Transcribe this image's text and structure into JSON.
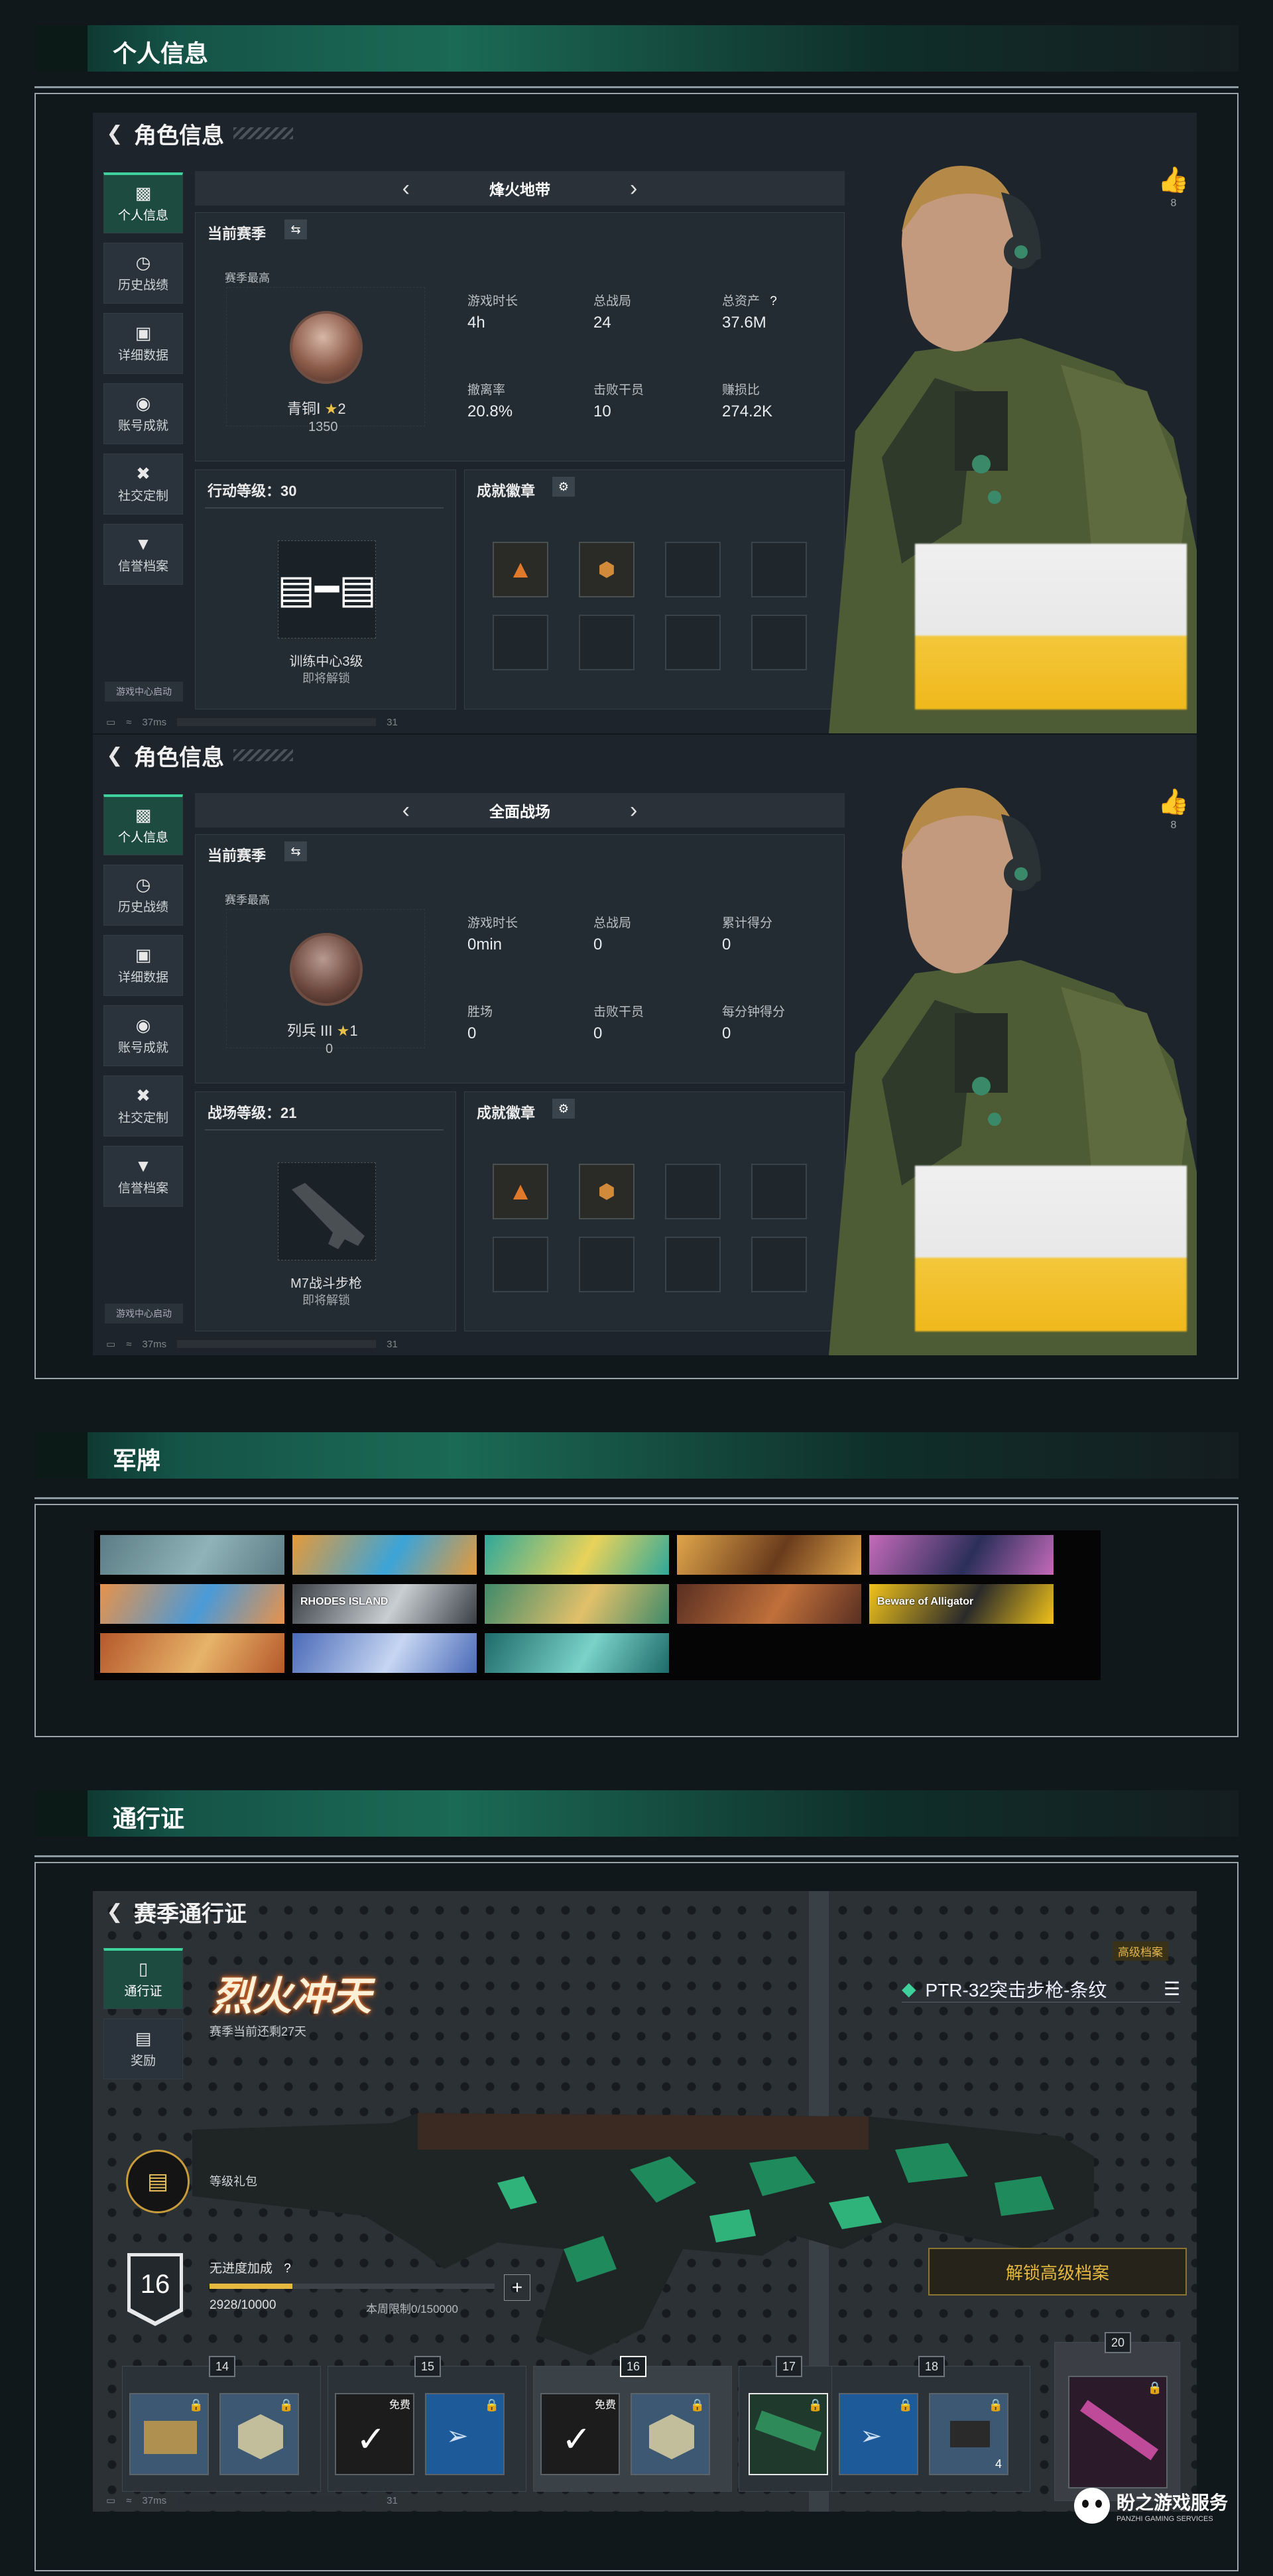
{
  "sections": {
    "personal": "个人信息",
    "plaques": "军牌",
    "pass": "通行证"
  },
  "profile": {
    "title": "角色信息",
    "sidebar": [
      "个人信息",
      "历史战绩",
      "详细数据",
      "账号成就",
      "社交定制",
      "信誉档案"
    ],
    "game_center": "游戏中心启动",
    "likes": "8",
    "status": {
      "ping": "37ms",
      "right": "31"
    },
    "season_label": "当前赛季",
    "season_best": "赛季最高",
    "achievements_label": "成就徽章",
    "panels": [
      {
        "mode": "烽火地带",
        "rank_name": "青铜Ⅰ",
        "rank_stars": "2",
        "rank_points": "1350",
        "stats": [
          {
            "label": "游戏时长",
            "value": "4h"
          },
          {
            "label": "总战局",
            "value": "24"
          },
          {
            "label": "总资产",
            "value": "37.6M",
            "help": "?"
          },
          {
            "label": "撤离率",
            "value": "20.8%"
          },
          {
            "label": "击败干员",
            "value": "10"
          },
          {
            "label": "赚损比",
            "value": "274.2K"
          }
        ],
        "level_title": "行动等级：30",
        "unlock_name": "训练中心3级",
        "unlock_hint": "即将解锁"
      },
      {
        "mode": "全面战场",
        "rank_name": "列兵 III",
        "rank_stars": "1",
        "rank_points": "0",
        "stats": [
          {
            "label": "游戏时长",
            "value": "0min"
          },
          {
            "label": "总战局",
            "value": "0"
          },
          {
            "label": "累计得分",
            "value": "0"
          },
          {
            "label": "胜场",
            "value": "0"
          },
          {
            "label": "击败干员",
            "value": "0"
          },
          {
            "label": "每分钟得分",
            "value": "0"
          }
        ],
        "level_title": "战场等级：21",
        "unlock_name": "M7战斗步枪",
        "unlock_hint": "即将解锁"
      }
    ]
  },
  "plaques": {
    "tiles": [
      {
        "color": "#5b7c84",
        "accent": "#8fb3b8"
      },
      {
        "color": "#e59a3a",
        "accent": "#3ba4d8"
      },
      {
        "color": "#2fa89a",
        "accent": "#e8d25a"
      },
      {
        "color": "#e0a54a",
        "accent": "#6a3b1c"
      },
      {
        "color": "#c46ab8",
        "accent": "#2b2f5a"
      },
      {
        "color": "#e8924a",
        "accent": "#4a9ad8"
      },
      {
        "color": "#3a3f46",
        "accent": "#c9ced2",
        "text": "RHODES ISLAND"
      },
      {
        "color": "#3f8a6a",
        "accent": "#e2c06a"
      },
      {
        "color": "#5a2f22",
        "accent": "#c0703a"
      },
      {
        "color": "#f0c21a",
        "accent": "#2a2a2a",
        "text": "Beware of Alligator"
      },
      {
        "color": "#b5582a",
        "accent": "#e7b36a"
      },
      {
        "color": "#4a6ab8",
        "accent": "#c6d6f2"
      },
      {
        "color": "#1d6a6a",
        "accent": "#7ad2c8"
      }
    ]
  },
  "pass": {
    "title": "赛季通行证",
    "sidebar": [
      "通行证",
      "奖励"
    ],
    "season_name": "烈火冲天",
    "remaining": "赛季当前还剩27天",
    "tag": "高级档案",
    "weapon": "PTR-32突击步枪-条纹",
    "gift": "等级礼包",
    "level": "16",
    "bonus_label": "无进度加成",
    "help": "?",
    "xp": "2928/10000",
    "xp_progress": 0.29,
    "weekly": "本周限制0/150000",
    "unlock_btn": "解锁高级档案",
    "free_label": "免费",
    "levels": [
      "14",
      "15",
      "16",
      "17",
      "18",
      "20"
    ],
    "item_count": "4",
    "status": {
      "ping": "37ms",
      "right": "31"
    }
  },
  "watermark": {
    "name": "盼之游戏服务",
    "sub": "PANZHI GAMING SERVICES"
  }
}
